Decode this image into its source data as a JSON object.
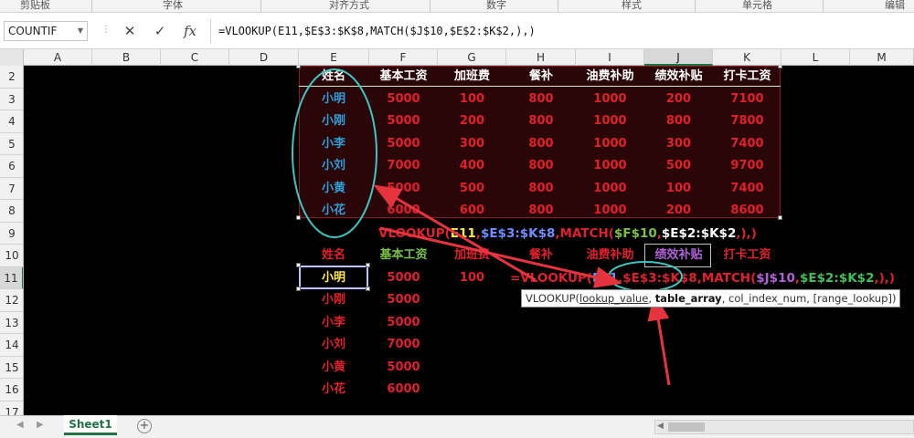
{
  "ribbon": {
    "groups": [
      "剪贴板",
      "字体",
      "对齐方式",
      "数字",
      "样式",
      "单元格",
      "编辑"
    ]
  },
  "formula_bar": {
    "name_box": "COUNTIF",
    "cancel_icon": "✕",
    "enter_icon": "✓",
    "fx_icon": "fx",
    "formula": "=VLOOKUP(E11,$E$3:$K$8,MATCH($J$10,$E$2:$K$2,),)"
  },
  "columns": [
    "A",
    "B",
    "C",
    "D",
    "E",
    "F",
    "G",
    "H",
    "I",
    "J",
    "K",
    "L",
    "M"
  ],
  "rows": [
    "2",
    "3",
    "4",
    "5",
    "6",
    "7",
    "8",
    "9",
    "10",
    "11",
    "12",
    "13",
    "14",
    "15",
    "16",
    "17"
  ],
  "source_table": {
    "headers": [
      "姓名",
      "基本工资",
      "加班费",
      "餐补",
      "油费补助",
      "绩效补贴",
      "打卡工资"
    ],
    "rows": [
      [
        "小明",
        "5000",
        "100",
        "800",
        "1000",
        "200",
        "7100"
      ],
      [
        "小刚",
        "5000",
        "200",
        "800",
        "1000",
        "800",
        "7800"
      ],
      [
        "小李",
        "5000",
        "300",
        "800",
        "1000",
        "300",
        "7400"
      ],
      [
        "小刘",
        "7000",
        "400",
        "800",
        "1000",
        "500",
        "9700"
      ],
      [
        "小黄",
        "5000",
        "500",
        "800",
        "1000",
        "100",
        "7400"
      ],
      [
        "小花",
        "6000",
        "600",
        "800",
        "1000",
        "200",
        "8600"
      ]
    ]
  },
  "annotation": {
    "formula_parts": [
      "VLOOKUP(",
      "E11",
      ",",
      "$E$3:$K$8",
      ",",
      "MATCH(",
      "$F$10",
      ",",
      "$E$2:$K$2",
      ",),)"
    ]
  },
  "lookup_table": {
    "headers": [
      "姓名",
      "基本工资",
      "加班费",
      "餐补",
      "油费补助",
      "绩效补贴",
      "打卡工资"
    ],
    "names": [
      "小明",
      "小刚",
      "小李",
      "小刘",
      "小黄",
      "小花"
    ],
    "salaries": [
      "5000",
      "5000",
      "5000",
      "7000",
      "5000",
      "6000"
    ],
    "g11_value": "100",
    "editing_parts": [
      "=VLOOKUP(",
      "E11",
      ",",
      "$E$3:$K$8",
      ",",
      "MATCH(",
      "$J$10",
      ",",
      "$E$2:$K$2",
      ",),)"
    ]
  },
  "tooltip": {
    "fn": "VLOOKUP(",
    "arg1": "lookup_value",
    "sep1": ", ",
    "arg2": "table_array",
    "sep2": ", ",
    "arg3": "col_index_num",
    "sep3": ", ",
    "arg4": "[range_lookup]",
    "end": ")"
  },
  "sheet_tabs": {
    "active": "Sheet1",
    "add_icon": "+"
  },
  "colors": {
    "header_text": "#ffffff",
    "name_text": "#2e9fd8",
    "value_text": "#e0202a",
    "salary_header": "#7ac143",
    "ref_yellow": "#ffe94a",
    "ref_blue": "#6f8dff",
    "ref_purple": "#b061d8",
    "ref_green": "#3fbf54",
    "ellipse": "#3fc6c3",
    "arrow": "#e6343f"
  }
}
